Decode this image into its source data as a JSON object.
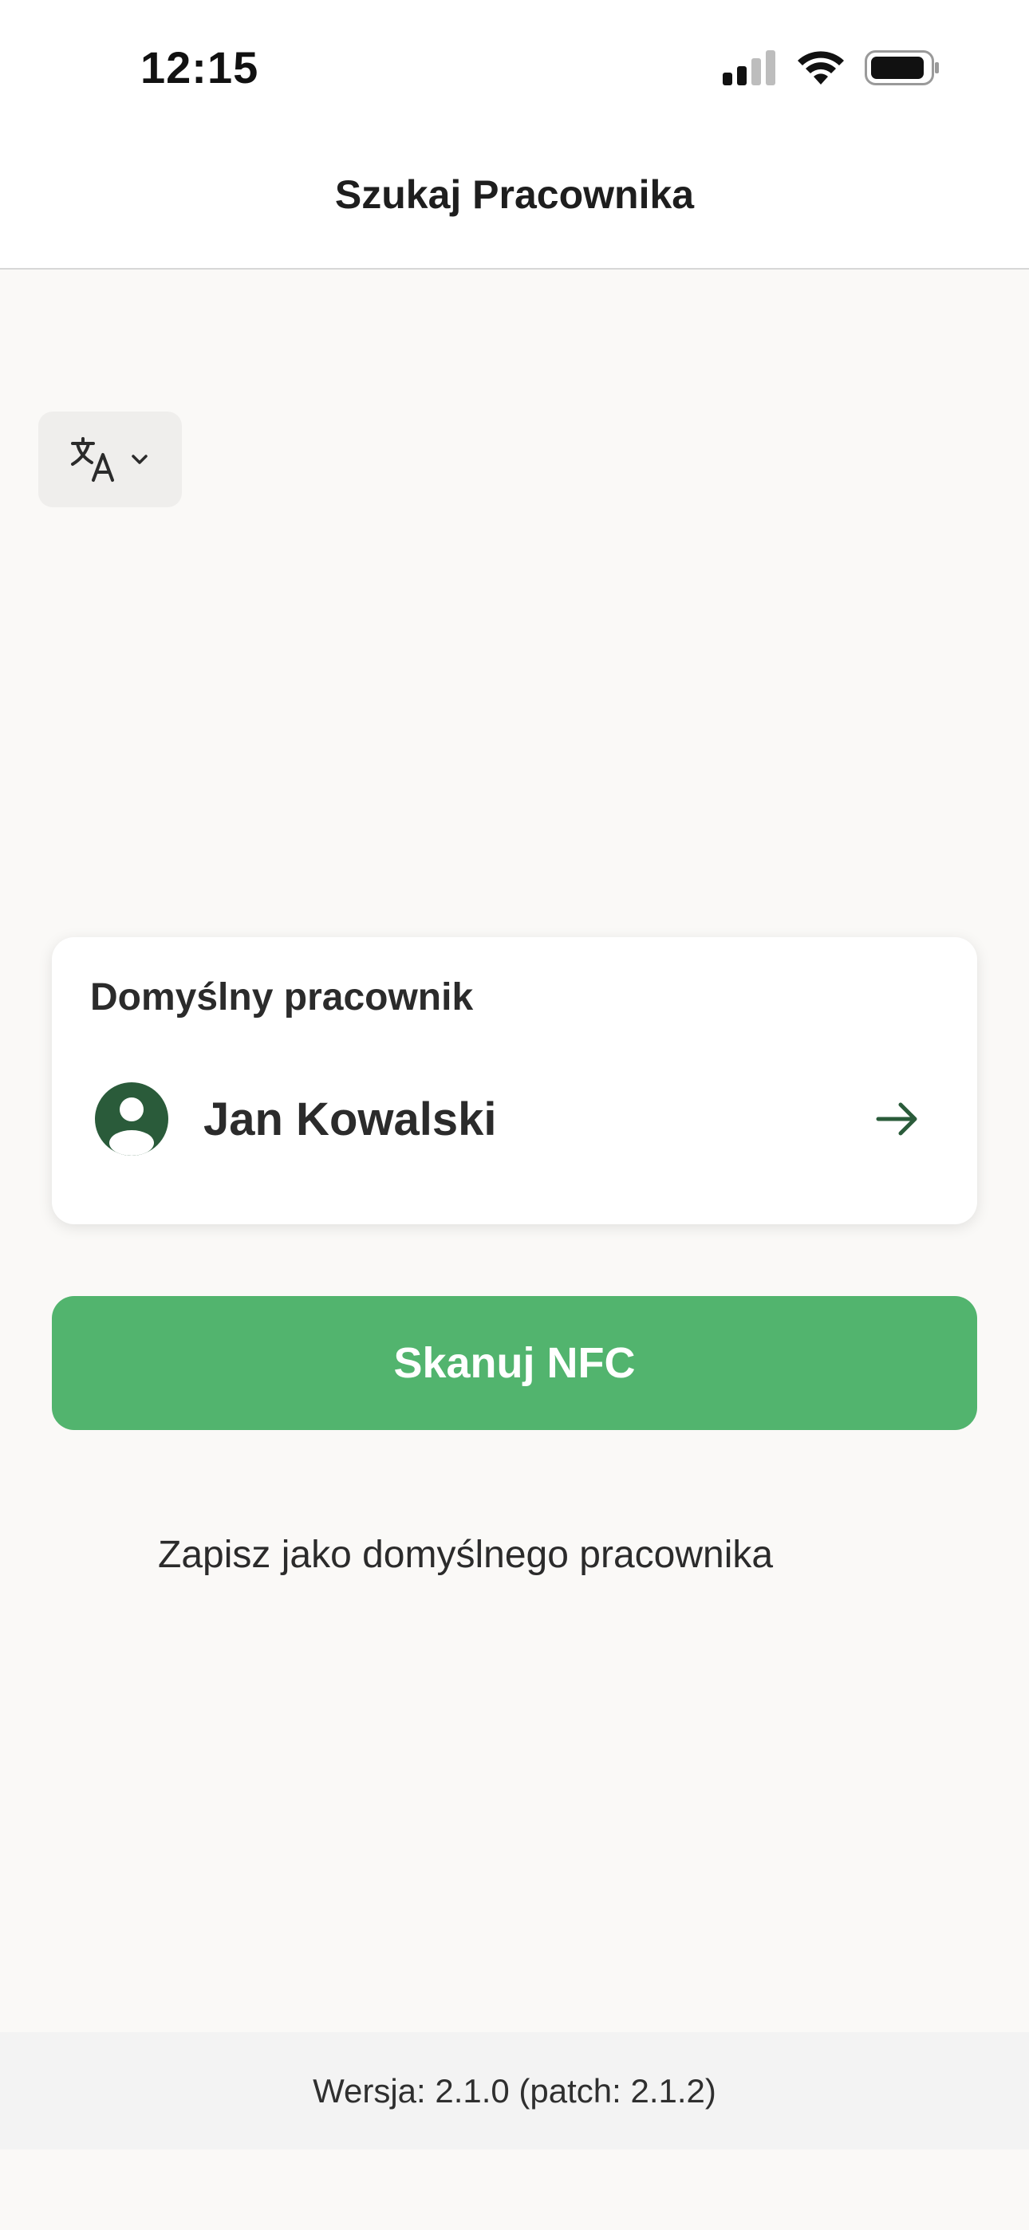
{
  "status_bar": {
    "time": "12:15"
  },
  "nav": {
    "title": "Szukaj Pracownika"
  },
  "language_selector": {
    "icon": "translate-icon"
  },
  "default_employee_card": {
    "title": "Domyślny pracownik",
    "employee_name": "Jan Kowalski"
  },
  "actions": {
    "scan_nfc_label": "Skanuj NFC",
    "save_default_label": "Zapisz jako domyślnego pracownika"
  },
  "footer": {
    "version_text": "Wersja: 2.1.0 (patch: 2.1.2)"
  },
  "colors": {
    "primary_green": "#52B46E",
    "dark_green": "#2A5B3A",
    "background": "#FAF9F7"
  }
}
